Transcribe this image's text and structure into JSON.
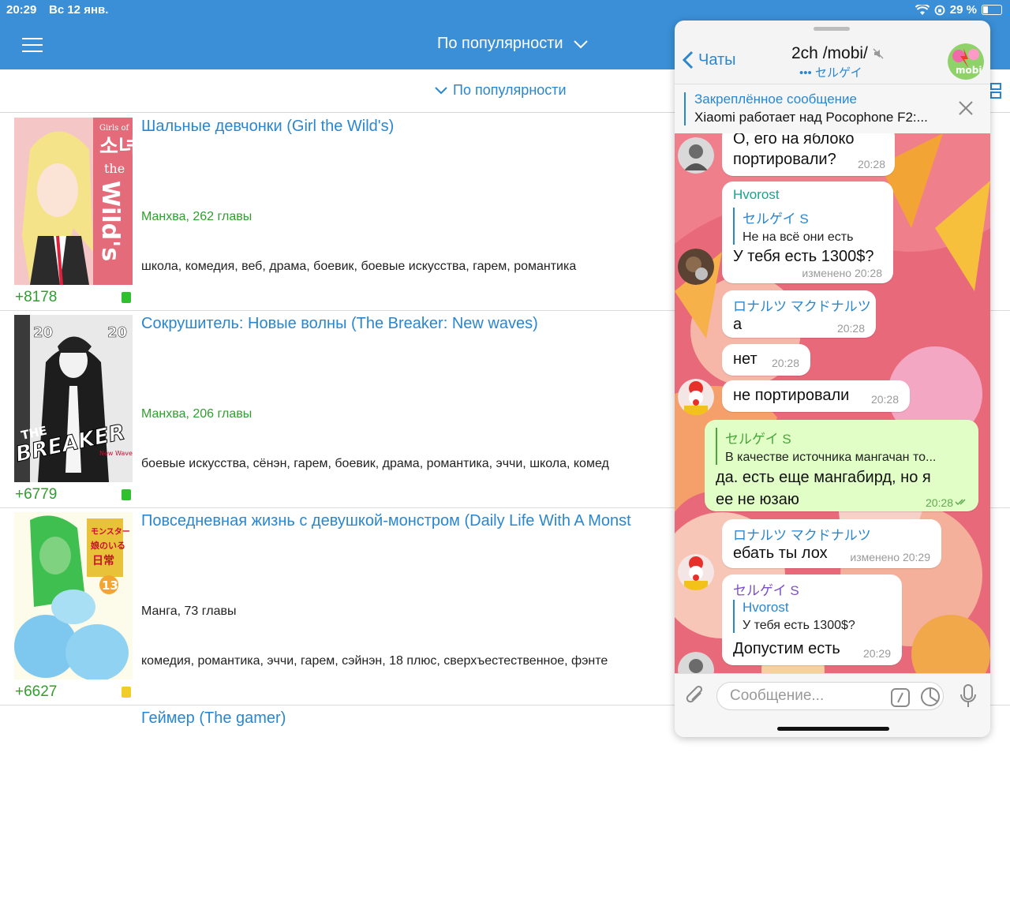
{
  "status_bar": {
    "time": "20:29",
    "date": "Вс 12 янв.",
    "battery": "29 %"
  },
  "header": {
    "title": "По популярности"
  },
  "sort": {
    "label": "По популярности"
  },
  "manga": [
    {
      "title": "Шальные девчонки (Girl the Wild's)",
      "meta": "Манхва, 262 главы",
      "tags": "школа, комедия, веб, драма, боевик, боевые искусства, гарем, романтика",
      "score": "+8178"
    },
    {
      "title": "Сокрушитель: Новые волны (The Breaker: New waves)",
      "meta": "Манхва, 206 главы",
      "tags": "боевые искусства, сёнэн, гарем, боевик, драма, романтика, эччи, школа, комед",
      "score": "+6779"
    },
    {
      "title": "Повседневная жизнь с девушкой-монстром (Daily Life With A Monst",
      "meta": "Манга, 73 главы",
      "tags": "комедия, романтика, эччи, гарем, сэйнэн, 18 плюс, сверхъестественное, фэнте",
      "score": "+6627"
    },
    {
      "title": "Геймер (The gamer)"
    }
  ],
  "cover_text": {
    "c1": [
      "Girls of",
      "소녀",
      "the",
      "Wild's"
    ],
    "c2": [
      "20",
      "20",
      "THE",
      "BREAKER",
      "New Waves"
    ],
    "c3": [
      "モンスター",
      "娘のいる",
      "日常",
      "13"
    ]
  },
  "colors": {
    "header_blue": "#3a8fd6",
    "link_blue": "#2a86cf",
    "score_green": "#2f9e2f",
    "outgoing_bubble": "#e1fec6",
    "mark_read": "#2fbf2f",
    "mark_yellow": "#f2cc2a"
  },
  "telegram": {
    "back_label": "Чаты",
    "chat_title": "2ch /mobi/",
    "chat_subtitle": "セルゲイ",
    "avatar_text": "mobi",
    "pinned_label": "Закреплённое сообщение",
    "pinned_text": "Xiaomi работает над Pocophone F2:...",
    "input_placeholder": "Сообщение...",
    "messages": [
      {
        "text1": "О, его на яблоко",
        "text2": "портировали?",
        "time": "20:28"
      },
      {
        "sender": "Hvorost",
        "reply_name": "セルゲイ S",
        "reply_text": "Не на всё они есть",
        "text": "У тебя есть 1300$?",
        "time": "изменено 20:28"
      },
      {
        "sender": "ロナルツ マクドナルツ",
        "text": "а",
        "time": "20:28"
      },
      {
        "text": "нет",
        "time": "20:28"
      },
      {
        "text": "не портировали",
        "time": "20:28"
      },
      {
        "reply_name": "セルゲイ S",
        "reply_text": "В качестве источника мангачан то...",
        "text1": "да. есть еще  мангабирд, но я",
        "text2": "ее не юзаю",
        "time": "20:28"
      },
      {
        "sender": "ロナルツ マクドナルツ",
        "text": "ебать ты лох",
        "time": "изменено 20:29"
      },
      {
        "sender": "セルゲイ S",
        "reply_name": "Hvorost",
        "reply_text": "У тебя есть 1300$?",
        "text": "Допустим есть",
        "time": "20:29"
      }
    ]
  }
}
